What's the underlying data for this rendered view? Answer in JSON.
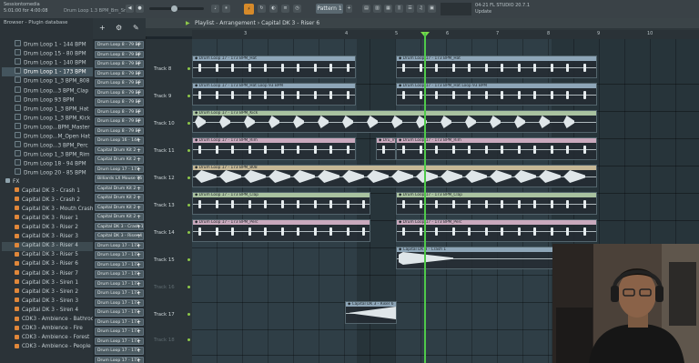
{
  "topbar": {
    "hint_line1": "Sessiontomedia",
    "hint_line2": "5:01:00 for 4:00:08",
    "song_hint": "Drum Loop 1.3 BPM_Bm_Snare",
    "pattern_label": "Pattern 1",
    "news_line1": "04-21  FL STUDIO 20.7.1",
    "news_line2": "Update"
  },
  "browser": {
    "header": "Browser - Plugin database",
    "items": [
      {
        "label": "Drum Loop 1 - 144 BPM",
        "kind": "loop",
        "indent": 1
      },
      {
        "label": "Drum Loop 15 - 80 BPM",
        "kind": "loop",
        "indent": 1
      },
      {
        "label": "Drum Loop 1 - 140 BPM",
        "kind": "loop",
        "indent": 1
      },
      {
        "label": "Drum Loop 1 - 173 BPM",
        "kind": "loop",
        "indent": 1,
        "selected": true
      },
      {
        "label": "Drum Loop 1_3 BPM_808",
        "kind": "loop",
        "indent": 1
      },
      {
        "label": "Drum Loop...3 BPM_Clap",
        "kind": "loop",
        "indent": 1
      },
      {
        "label": "Drum Loop 93 BPM",
        "kind": "loop",
        "indent": 1
      },
      {
        "label": "Drum Loop 1_3 BPM_Hat",
        "kind": "loop",
        "indent": 1
      },
      {
        "label": "Drum Loop 1_3 BPM_Kick",
        "kind": "loop",
        "indent": 1
      },
      {
        "label": "Drum Loop...BPM_Master",
        "kind": "loop",
        "indent": 1
      },
      {
        "label": "Drum Loop...M_Open Hat",
        "kind": "loop",
        "indent": 1
      },
      {
        "label": "Drum Loop...3 BPM_Perc",
        "kind": "loop",
        "indent": 1
      },
      {
        "label": "Drum Loop 1_3 BPM_Rim",
        "kind": "loop",
        "indent": 1
      },
      {
        "label": "Drum Loop 18 - 94 BPM",
        "kind": "loop",
        "indent": 1
      },
      {
        "label": "Drum Loop 20 - 85 BPM",
        "kind": "loop",
        "indent": 1
      },
      {
        "label": "FX",
        "kind": "folder",
        "indent": 0
      },
      {
        "label": "Capital DK 3 - Crash 1",
        "kind": "sample",
        "indent": 1
      },
      {
        "label": "Capital DK 3 - Crash 2",
        "kind": "sample",
        "indent": 1
      },
      {
        "label": "Capital DK 3 - Mouth Crash",
        "kind": "sample",
        "indent": 1
      },
      {
        "label": "Capital DK 3 - Riser 1",
        "kind": "sample",
        "indent": 1
      },
      {
        "label": "Capital DK 3 - Riser 2",
        "kind": "sample",
        "indent": 1
      },
      {
        "label": "Capital DK 3 - Riser 3",
        "kind": "sample",
        "indent": 1
      },
      {
        "label": "Capital DK 3 - Riser 4",
        "kind": "sample",
        "indent": 1,
        "highlight": true
      },
      {
        "label": "Capital DK 3 - Riser 5",
        "kind": "sample",
        "indent": 1
      },
      {
        "label": "Capital DK 3 - Riser 6",
        "kind": "sample",
        "indent": 1
      },
      {
        "label": "Capital DK 3 - Riser 7",
        "kind": "sample",
        "indent": 1
      },
      {
        "label": "Capital DK 3 - Siren 1",
        "kind": "sample",
        "indent": 1
      },
      {
        "label": "Capital DK 3 - Siren 2",
        "kind": "sample",
        "indent": 1
      },
      {
        "label": "Capital DK 3 - Siren 3",
        "kind": "sample",
        "indent": 1
      },
      {
        "label": "Capital DK 3 - Siren 4",
        "kind": "sample",
        "indent": 1
      },
      {
        "label": "CDK3 - Ambience - Bathroom",
        "kind": "sample",
        "indent": 1
      },
      {
        "label": "CDK3 - Ambience - Fire",
        "kind": "sample",
        "indent": 1
      },
      {
        "label": "CDK3 - Ambience - Forest",
        "kind": "sample",
        "indent": 1
      },
      {
        "label": "CDK3 - Ambience - People",
        "kind": "sample",
        "indent": 1
      }
    ]
  },
  "channels": [
    "Drum Loop 8 - 79 BP",
    "Drum Loop 8 - 79 BP",
    "Drum Loop 8 - 79 BP",
    "Drum Loop 8 - 79 BP",
    "Drum Loop 8 - 79 BP",
    "Drum Loop 8 - 79 BP",
    "Drum Loop 8 - 79 BP",
    "Drum Loop 8 - 79 BP",
    "Drum Loop 8 - 79 BP",
    "Drum Loop 8 - 79 BP",
    "Drum Loop 16 - 144",
    "Capital Drum Kit 2",
    "Capital Drum Kit 2",
    "Drum Loop 17 - 173",
    "Billiards LX Mouse 75",
    "Capital Drum Kit 2",
    "Capital Drum Kit 2",
    "Capital Drum Kit 2",
    "Capital Drum Kit 2",
    "Capital DK 3 - Crash 1",
    "Capital DK 3 - Riser 4",
    "Drum Loop 17 - 173",
    "Drum Loop 17 - 173",
    "Drum Loop 17 - 173",
    "Drum Loop 17 - 173",
    "Drum Loop 17 - 173",
    "Drum Loop 17 - 173",
    "Drum Loop 17 - 173",
    "Drum Loop 17 - 173",
    "Drum Loop 17 - 173",
    "Drum Loop 17 - 173",
    "Drum Loop 17 - 173",
    "Drum Loop 17 - 173",
    "Drum Loop 17 - 173",
    "Drum Loop 17 - 173"
  ],
  "playlist": {
    "breadcrumb": "Playlist - Arrangement  ›  Capital DK 3 - Riser 6",
    "ruler": [
      "3",
      "4",
      "5",
      "6",
      "7",
      "8",
      "9",
      "10"
    ],
    "tracks": [
      {
        "label": "Track 8",
        "dim": false
      },
      {
        "label": "Track 9",
        "dim": false
      },
      {
        "label": "Track 10",
        "dim": false
      },
      {
        "label": "Track 11",
        "dim": false
      },
      {
        "label": "Track 12",
        "dim": false
      },
      {
        "label": "Track 13",
        "dim": false
      },
      {
        "label": "Track 14",
        "dim": false
      },
      {
        "label": "Track 15",
        "dim": false
      },
      {
        "label": "Track 16",
        "dim": true
      },
      {
        "label": "Track 17",
        "dim": false
      },
      {
        "label": "Track 18",
        "dim": true
      }
    ],
    "clips": [
      {
        "row": 0,
        "label": "Drum Loop 17 - 173 BPM_Hat",
        "color": "blue"
      },
      {
        "row": 1,
        "label": "Drum Loop 17 - 173 BPM_Hat Loop 93 BPM",
        "color": "blue"
      },
      {
        "row": 2,
        "label": "Drum Loop 17 - 173 BPM_Kick",
        "color": "green"
      },
      {
        "row": 3,
        "label": "Drum Loop 17 - 173 BPM_Rim",
        "color": "pink"
      },
      {
        "row": 3,
        "label": "Dru_m",
        "color": "pink"
      },
      {
        "row": 4,
        "label": "Drum Loop 17 - 173 BPM_808",
        "color": "sand"
      },
      {
        "row": 5,
        "label": "Drum Loop 17 - 173 BPM_Clap",
        "color": "green"
      },
      {
        "row": 6,
        "label": "Drum Loop 17 - 173 BPM_Perc",
        "color": "pink"
      },
      {
        "row": 7,
        "label": "Capital DK 3 - Crash 1",
        "color": "blue"
      },
      {
        "row": 9,
        "label": "Capital DK 3 - Riser 6",
        "color": "blue"
      }
    ]
  }
}
